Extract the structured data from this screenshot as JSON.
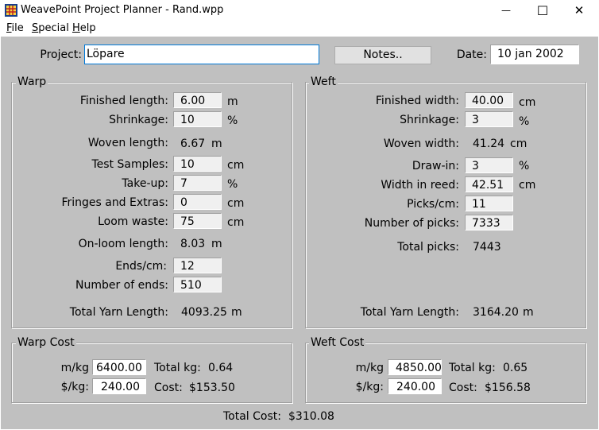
{
  "window": {
    "title": "WeavePoint Project Planner - Rand.wpp",
    "minimize_glyph": "—",
    "maximize_glyph": "☐",
    "close_glyph": "✕"
  },
  "menu": {
    "file": {
      "accel": "F",
      "rest": "ile"
    },
    "special": {
      "accel": "S",
      "rest": "pecial"
    },
    "help": {
      "accel": "H",
      "rest": "elp"
    }
  },
  "header": {
    "project_label": "Project:",
    "project_value": "Löpare",
    "notes_button": "Notes..",
    "date_label": "Date:",
    "date_value": "10 jan 2002"
  },
  "warp": {
    "title": "Warp",
    "finished_length": {
      "label": "Finished length:",
      "value": "6.00",
      "unit": "m"
    },
    "shrinkage": {
      "label": "Shrinkage:",
      "value": "10",
      "unit": "%"
    },
    "woven_length": {
      "label": "Woven length:",
      "value": "6.67",
      "unit": "m"
    },
    "test_samples": {
      "label": "Test Samples:",
      "value": "10",
      "unit": "cm"
    },
    "take_up": {
      "label": "Take-up:",
      "value": "7",
      "unit": "%"
    },
    "fringes": {
      "label": "Fringes and Extras:",
      "value": "0",
      "unit": "cm"
    },
    "loom_waste": {
      "label": "Loom waste:",
      "value": "75",
      "unit": "cm"
    },
    "on_loom_length": {
      "label": "On-loom length:",
      "value": "8.03",
      "unit": "m"
    },
    "ends_cm": {
      "label": "Ends/cm:",
      "value": "12"
    },
    "number_of_ends": {
      "label": "Number of ends:",
      "value": "510"
    },
    "total_yarn": {
      "label": "Total Yarn Length:",
      "value": "4093.25",
      "unit": "m"
    }
  },
  "weft": {
    "title": "Weft",
    "finished_width": {
      "label": "Finished width:",
      "value": "40.00",
      "unit": "cm"
    },
    "shrinkage": {
      "label": "Shrinkage:",
      "value": "3",
      "unit": "%"
    },
    "woven_width": {
      "label": "Woven width:",
      "value": "41.24",
      "unit": "cm"
    },
    "draw_in": {
      "label": "Draw-in:",
      "value": "3",
      "unit": "%"
    },
    "width_in_reed": {
      "label": "Width in reed:",
      "value": "42.51",
      "unit": "cm"
    },
    "picks_cm": {
      "label": "Picks/cm:",
      "value": "11"
    },
    "number_of_picks": {
      "label": "Number of picks:",
      "value": "7333"
    },
    "total_picks": {
      "label": "Total picks:",
      "value": "7443"
    },
    "total_yarn": {
      "label": "Total Yarn Length:",
      "value": "3164.20",
      "unit": "m"
    }
  },
  "warp_cost": {
    "title": "Warp Cost",
    "m_kg": {
      "label": "m/kg",
      "value": "6400.00"
    },
    "price_kg": {
      "label": "$/kg:",
      "value": "240.00"
    },
    "total_kg": {
      "label": "Total kg:",
      "value": "0.64"
    },
    "cost": {
      "label": "Cost:",
      "value": "$153.50"
    }
  },
  "weft_cost": {
    "title": "Weft Cost",
    "m_kg": {
      "label": "m/kg",
      "value": "4850.00"
    },
    "price_kg": {
      "label": "$/kg:",
      "value": "240.00"
    },
    "total_kg": {
      "label": "Total kg:",
      "value": "0.65"
    },
    "cost": {
      "label": "Cost:",
      "value": "$156.58"
    }
  },
  "total_cost": {
    "label": "Total Cost:",
    "value": "$310.08"
  }
}
